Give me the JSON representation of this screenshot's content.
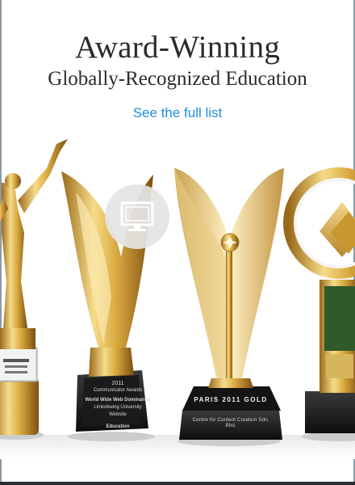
{
  "header": {
    "title": "Award-Winning",
    "subtitle": "Globally-Recognized Education"
  },
  "link": {
    "label": "See the full list"
  },
  "awards": {
    "plaque_1": {
      "year": "2011",
      "name": "Communicator Awards",
      "org": "World Wide Web Dominance",
      "recipient": "Limkokwing University",
      "type": "Website",
      "category": "Education"
    },
    "plaque_2": {
      "band": "PARIS  2011  GOLD",
      "recipient": "Centre for Content Creation Sdn. Bhd."
    }
  },
  "video_icon": "monitor-play-icon",
  "colors": {
    "link": "#1e8fdc",
    "title": "#2b2b2b",
    "gold": "#d4a93c"
  }
}
